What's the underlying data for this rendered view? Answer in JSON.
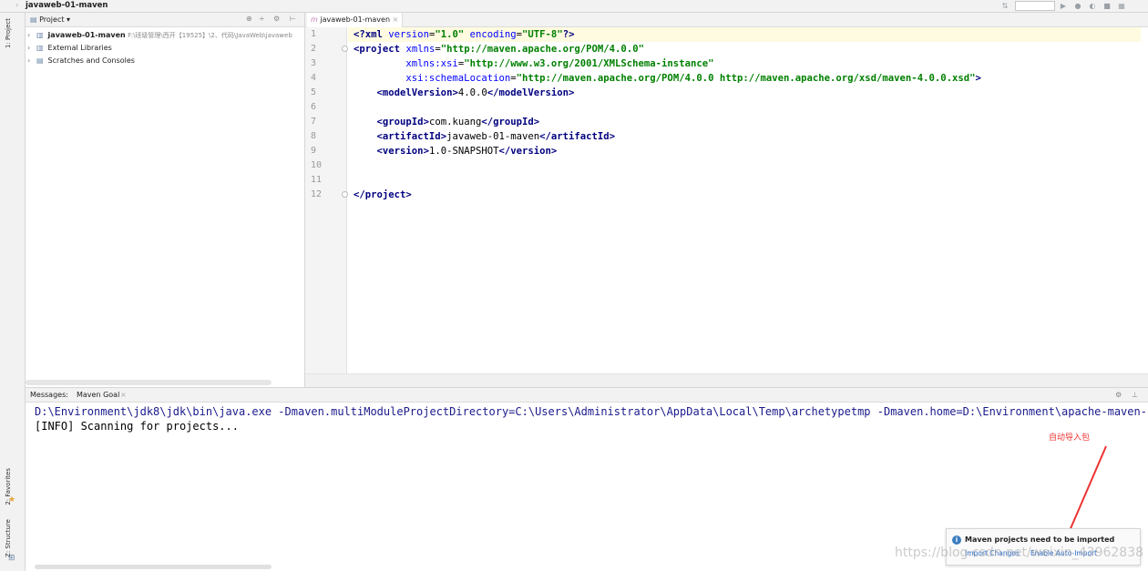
{
  "title_bar": {
    "project_crumb": "javaweb-01-maven",
    "crumb_arrow": "›"
  },
  "left_strip": {
    "project_tab": "1: Project",
    "favorites_tab": "2: Favorites",
    "structure_tab": "Z: Structure"
  },
  "project_panel": {
    "header_title": "Project",
    "tree": [
      {
        "label": "javaweb-01-maven",
        "path": "F:\\班级管理\\西开【19525】\\2、代码\\JavaWeb\\javaweb"
      },
      {
        "label": "External Libraries"
      },
      {
        "label": "Scratches and Consoles"
      }
    ]
  },
  "editor": {
    "tab_label": "javaweb-01-maven",
    "tab_close": "×",
    "line_numbers": [
      "1",
      "2",
      "3",
      "4",
      "5",
      "6",
      "7",
      "8",
      "9",
      "10",
      "11",
      "12"
    ],
    "code": {
      "l1": {
        "open": "<?",
        "tag": "xml",
        "a1": "version",
        "v1": "\"1.0\"",
        "a2": "encoding",
        "v2": "\"UTF-8\"",
        "close": "?>"
      },
      "l2": {
        "open": "<",
        "tag": "project",
        "attr": "xmlns",
        "val": "\"http://maven.apache.org/POM/4.0.0\""
      },
      "l3": {
        "attr": "xmlns:xsi",
        "val": "\"http://www.w3.org/2001/XMLSchema-instance\""
      },
      "l4": {
        "attr": "xsi:schemaLocation",
        "val": "\"http://maven.apache.org/POM/4.0.0 http://maven.apache.org/xsd/maven-4.0.0.xsd\"",
        "close": ">"
      },
      "l5": {
        "tag": "modelVersion",
        "text": "4.0.0"
      },
      "l7": {
        "tag": "groupId",
        "text": "com.kuang"
      },
      "l8": {
        "tag": "artifactId",
        "text": "javaweb-01-maven"
      },
      "l9": {
        "tag": "version",
        "text": "1.0-SNAPSHOT"
      },
      "l12": {
        "tag": "project"
      }
    }
  },
  "bottom_panel": {
    "tabs": [
      "Messages:",
      "Maven Goal"
    ],
    "tab_close": "×",
    "console_lines": [
      "D:\\Environment\\jdk8\\jdk\\bin\\java.exe -Dmaven.multiModuleProjectDirectory=C:\\Users\\Administrator\\AppData\\Local\\Temp\\archetypetmp -Dmaven.home=D:\\Environment\\apache-maven-",
      "[INFO] Scanning for projects..."
    ]
  },
  "annotation": {
    "text": "自动导入包",
    "color": "#e33333"
  },
  "notification": {
    "title": "Maven projects need to be imported",
    "import_link": "Import Changes",
    "auto_link": "Enable Auto-Import"
  },
  "watermark": "https://blog.csdn.net/weixin_43962838",
  "colors": {
    "tag": "#000080",
    "attribute": "#0000ff",
    "string": "#008000",
    "link": "#2a6ac8"
  }
}
